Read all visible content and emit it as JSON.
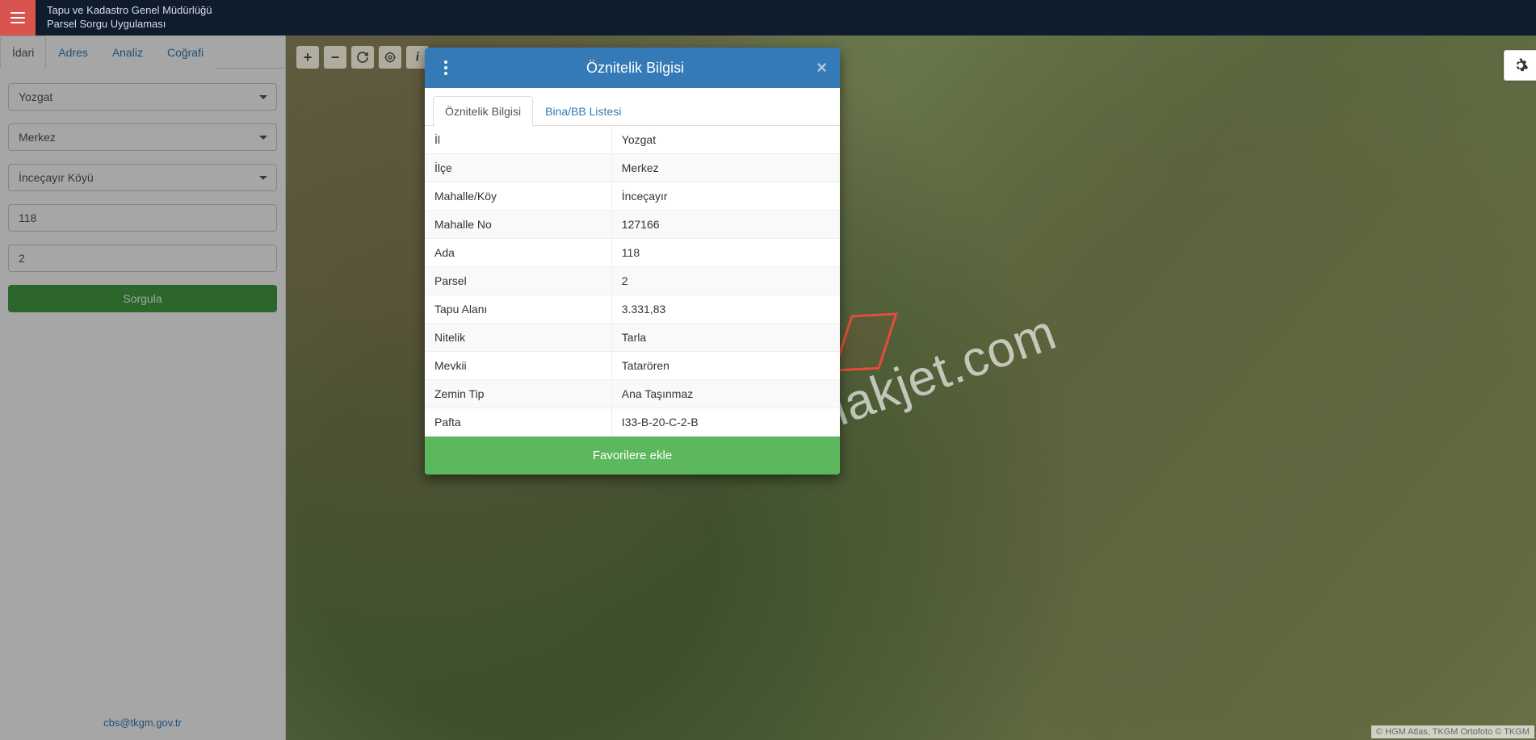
{
  "navbar": {
    "title1": "Tapu ve Kadastro Genel Müdürlüğü",
    "title2": "Parsel Sorgu Uygulaması"
  },
  "sidebar": {
    "tabs": [
      {
        "label": "İdari",
        "active": true
      },
      {
        "label": "Adres",
        "active": false
      },
      {
        "label": "Analiz",
        "active": false
      },
      {
        "label": "Coğrafi",
        "active": false
      }
    ],
    "form": {
      "il": "Yozgat",
      "ilce": "Merkez",
      "mahalle": "İnceçayır Köyü",
      "ada": "118",
      "parsel": "2",
      "button": "Sorgula"
    },
    "footer_email": "cbs@tkgm.gov.tr"
  },
  "map_tools": {
    "zoom_in": "+",
    "zoom_out": "−",
    "refresh": "refresh-icon",
    "locate": "locate-icon",
    "info": "i"
  },
  "modal": {
    "title": "Öznitelik Bilgisi",
    "tabs": [
      {
        "label": "Öznitelik Bilgisi",
        "active": true
      },
      {
        "label": "Bina/BB Listesi",
        "active": false
      }
    ],
    "rows": [
      {
        "key": "İl",
        "value": "Yozgat"
      },
      {
        "key": "İlçe",
        "value": "Merkez"
      },
      {
        "key": "Mahalle/Köy",
        "value": "İnceçayır"
      },
      {
        "key": "Mahalle No",
        "value": "127166"
      },
      {
        "key": "Ada",
        "value": "118"
      },
      {
        "key": "Parsel",
        "value": "2"
      },
      {
        "key": "Tapu Alanı",
        "value": "3.331,83"
      },
      {
        "key": "Nitelik",
        "value": "Tarla"
      },
      {
        "key": "Mevkii",
        "value": "Tatarören"
      },
      {
        "key": "Zemin Tip",
        "value": "Ana Taşınmaz"
      },
      {
        "key": "Pafta",
        "value": "I33-B-20-C-2-B"
      }
    ],
    "footer_button": "Favorilere ekle"
  },
  "watermark": "emlakjet.com",
  "attribution": "© HGM Atlas, TKGM Ortofoto © TKGM"
}
